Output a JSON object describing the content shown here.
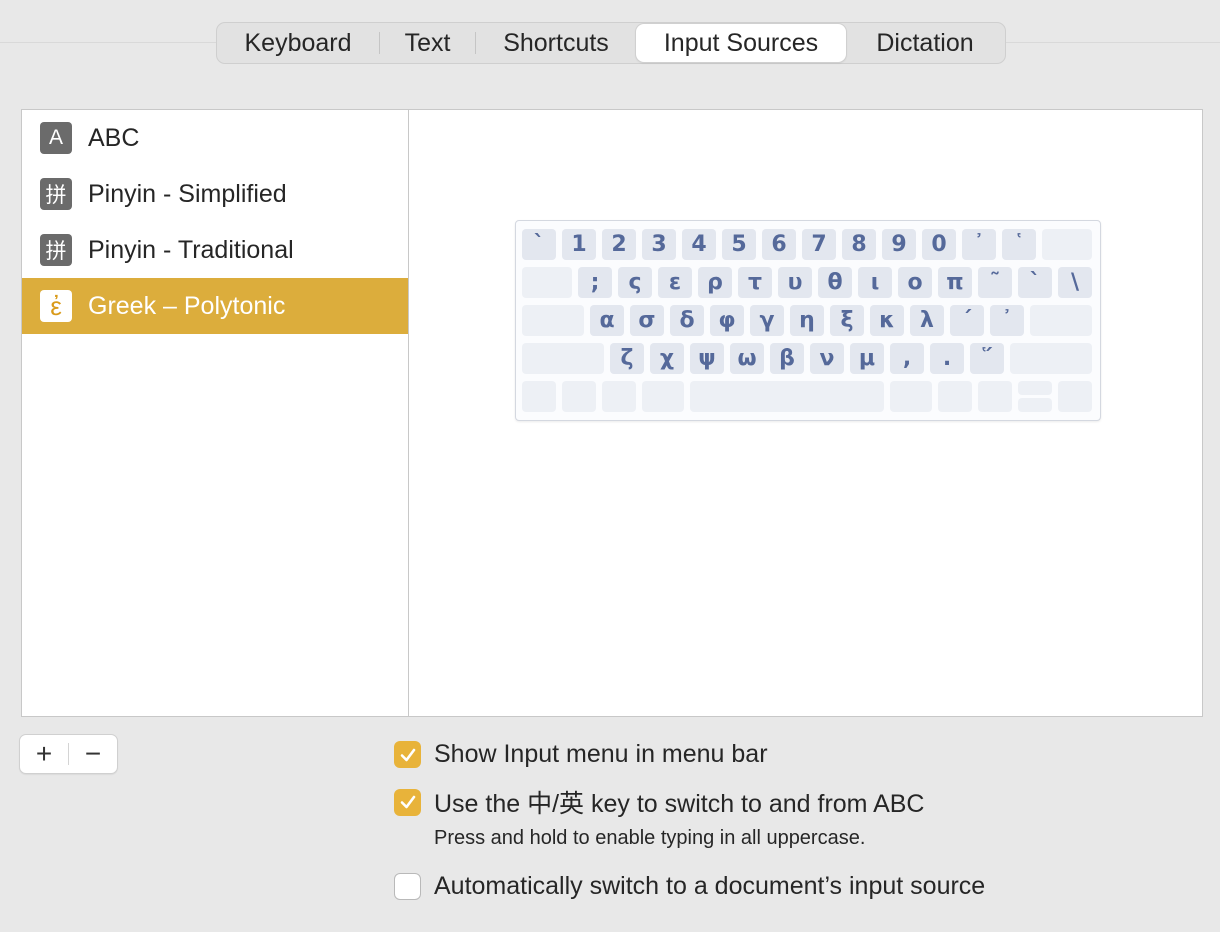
{
  "tabs": [
    "Keyboard",
    "Text",
    "Shortcuts",
    "Input Sources",
    "Dictation"
  ],
  "active_tab": "Input Sources",
  "input_sources": [
    {
      "icon_char": "A",
      "icon": "abc-icon",
      "label": "ABC"
    },
    {
      "icon_char": "拼",
      "icon": "pinyin-icon",
      "label": "Pinyin - Simplified"
    },
    {
      "icon_char": "拼",
      "icon": "pinyin-icon",
      "label": "Pinyin - Traditional"
    },
    {
      "icon_char": "ἐ",
      "icon": "greek-icon",
      "label": "Greek – Polytonic"
    }
  ],
  "selected_source": "Greek – Polytonic",
  "keyboard": {
    "row1": [
      "`",
      "1",
      "2",
      "3",
      "4",
      "5",
      "6",
      "7",
      "8",
      "9",
      "0",
      "᾿",
      "῾"
    ],
    "row2": [
      ";",
      "ς",
      "ε",
      "ρ",
      "τ",
      "υ",
      "θ",
      "ι",
      "ο",
      "π",
      "῀",
      "`",
      "\\"
    ],
    "row3": [
      "α",
      "σ",
      "δ",
      "φ",
      "γ",
      "η",
      "ξ",
      "κ",
      "λ",
      "´",
      "᾽"
    ],
    "row4": [
      "ζ",
      "χ",
      "ψ",
      "ω",
      "β",
      "ν",
      "μ",
      ",",
      ".",
      "῞"
    ]
  },
  "buttons": {
    "add": "+",
    "remove": "−"
  },
  "options": {
    "show_menu": {
      "label": "Show Input menu in menu bar",
      "checked": true
    },
    "use_key": {
      "label": "Use the 中/英 key to switch to and from ABC",
      "checked": true
    },
    "use_key_hint": "Press and hold to enable typing in all uppercase.",
    "auto_switch": {
      "label": "Automatically switch to a document’s input source",
      "checked": false
    }
  },
  "colors": {
    "accent": "#dcad3c",
    "checkbox": "#e8b33a",
    "key_text": "#55699a"
  }
}
